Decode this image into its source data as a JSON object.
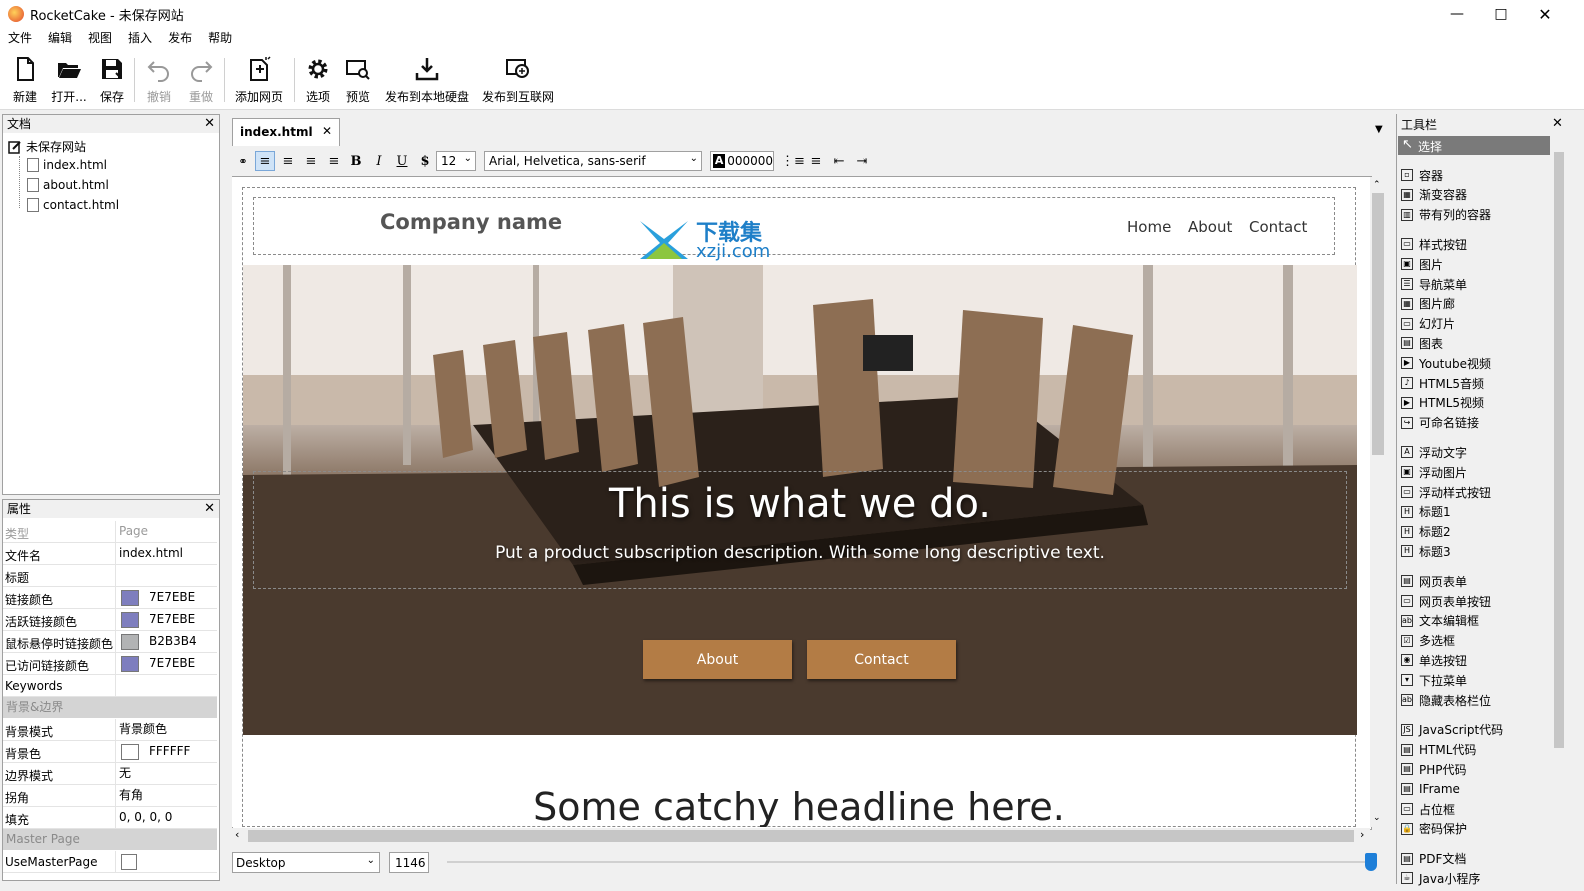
{
  "window": {
    "title": "RocketCake - 未保存网站",
    "minimize_icon": "minimize-icon",
    "maximize_icon": "maximize-icon",
    "close_icon": "close-icon"
  },
  "menu": [
    "文件",
    "编辑",
    "视图",
    "插入",
    "发布",
    "帮助"
  ],
  "toolbar": {
    "new": "新建",
    "open": "打开...",
    "save": "保存",
    "undo": "撤销",
    "redo": "重做",
    "add_page": "添加网页",
    "options": "选项",
    "preview": "预览",
    "publish_local": "发布到本地硬盘",
    "publish_web": "发布到互联网"
  },
  "documents_panel": {
    "title": "文档",
    "root": "未保存网站",
    "files": [
      "index.html",
      "about.html",
      "contact.html"
    ]
  },
  "properties_panel": {
    "title": "属性",
    "rows": [
      {
        "key": "类型",
        "value": "Page",
        "dim": true
      },
      {
        "key": "文件名",
        "value": "index.html"
      },
      {
        "key": "标题",
        "value": ""
      },
      {
        "key": "链接颜色",
        "value": "7E7EBE",
        "color": "#7e7ebe"
      },
      {
        "key": "活跃链接颜色",
        "value": "7E7EBE",
        "color": "#7e7ebe"
      },
      {
        "key": "鼠标悬停时链接颜色",
        "value": "B2B3B4",
        "color": "#b2b3b4"
      },
      {
        "key": "已访问链接颜色",
        "value": "7E7EBE",
        "color": "#7e7ebe"
      },
      {
        "key": "Keywords",
        "value": ""
      }
    ],
    "section_bg": "背景&边界",
    "rows2": [
      {
        "key": "背景模式",
        "value": "背景颜色"
      },
      {
        "key": "背景色",
        "value": "FFFFFF",
        "color": "#ffffff"
      },
      {
        "key": "边界模式",
        "value": "无"
      },
      {
        "key": "拐角",
        "value": "有角"
      },
      {
        "key": "填充",
        "value": "0, 0, 0, 0"
      }
    ],
    "section_master": "Master Page",
    "use_master": "UseMasterPage"
  },
  "editor": {
    "tab": "index.html",
    "font_size": "12",
    "font_family": "Arial, Helvetica, sans-serif",
    "color_value": "000000",
    "device": "Desktop",
    "width": "1146"
  },
  "page": {
    "company": "Company name",
    "nav": [
      "Home",
      "About",
      "Contact"
    ],
    "hero_title": "This is what we do.",
    "hero_sub": "Put a product subscription description. With some long descriptive text.",
    "btn_about": "About",
    "btn_contact": "Contact",
    "headline": "Some catchy headline here.",
    "watermark_text": "下载集",
    "watermark_url": "xzji.com"
  },
  "toolbox": {
    "title": "工具栏",
    "selected": "选择",
    "groups": [
      [
        "容器",
        "渐变容器",
        "带有列的容器"
      ],
      [
        "样式按钮",
        "图片",
        "导航菜单",
        "图片廊",
        "幻灯片",
        "图表",
        "Youtube视频",
        "HTML5音频",
        "HTML5视频",
        "可命名链接"
      ],
      [
        "浮动文字",
        "浮动图片",
        "浮动样式按钮",
        "标题1",
        "标题2",
        "标题3"
      ],
      [
        "网页表单",
        "网页表单按钮",
        "文本编辑框",
        "多选框",
        "单选按钮",
        "下拉菜单",
        "隐藏表格栏位"
      ],
      [
        "JavaScript代码",
        "HTML代码",
        "PHP代码",
        "IFrame",
        "占位框",
        "密码保护"
      ],
      [
        "PDF文档",
        "Java小程序"
      ]
    ]
  }
}
